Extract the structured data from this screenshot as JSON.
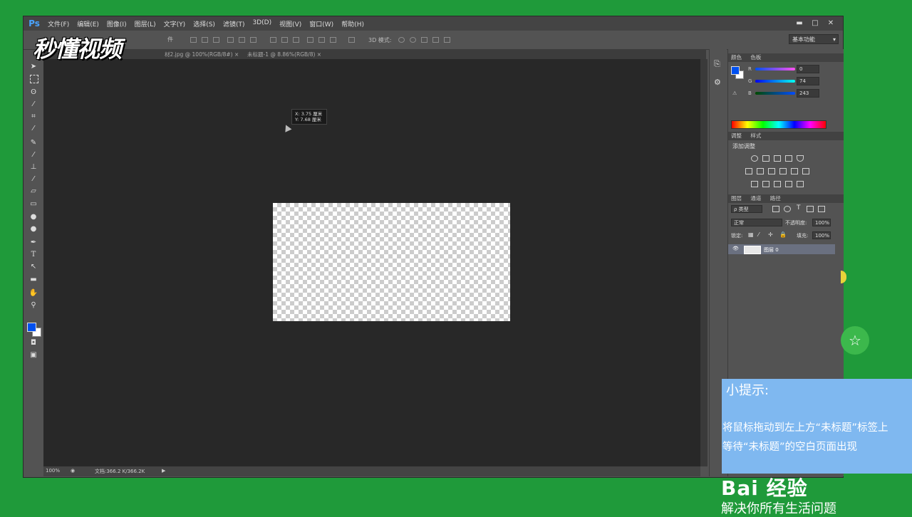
{
  "app": {
    "logo": "Ps",
    "menu": [
      "文件(F)",
      "编辑(E)",
      "图像(I)",
      "图层(L)",
      "文字(Y)",
      "选择(S)",
      "滤镜(T)",
      "3D(D)",
      "视图(V)",
      "窗口(W)",
      "帮助(H)"
    ],
    "window_controls": [
      "▬",
      "□",
      "✕"
    ]
  },
  "options_bar": {
    "partial_label": "件",
    "mode_3d": "3D 模式:",
    "workspace": "基本功能"
  },
  "tabs": [
    {
      "label": "材2.jpg @ 100%(RGB/8#)",
      "close": "×"
    },
    {
      "label": "未标题-1 @ 8.86%(RGB/8)",
      "close": "×"
    }
  ],
  "tooltip": {
    "line1": "X: 3.75 厘米",
    "line2": "Y: 7.68 厘米"
  },
  "status": {
    "zoom": "100%",
    "doc": "文档:366.2 K/366.2K"
  },
  "color_panel": {
    "tabs": [
      "颜色",
      "色板"
    ],
    "r_label": "R",
    "r_value": "0",
    "g_label": "G",
    "g_value": "74",
    "b_label": "B",
    "b_value": "243",
    "foreground": "#0050f0",
    "background": "#ffffff"
  },
  "adjust_panel": {
    "tabs": [
      "调整",
      "样式"
    ],
    "add_label": "添加调整"
  },
  "layers_panel": {
    "tabs": [
      "图层",
      "通道",
      "路径"
    ],
    "filter": "ρ 类型",
    "blend_mode": "正常",
    "opacity_label": "不透明度:",
    "opacity_value": "100%",
    "lock_label": "锁定:",
    "fill_label": "填充:",
    "fill_value": "100%",
    "layer_name": "图层 0"
  },
  "watermark": "秒懂视频",
  "hint": {
    "title": "小提示:",
    "line1": "将鼠标拖动到左上方“未标题”标签上",
    "line2": "等待“未标题”的空白页面出现"
  },
  "baidu": {
    "logo": "Bai 经验",
    "slogan": "解决你所有生活问题"
  }
}
